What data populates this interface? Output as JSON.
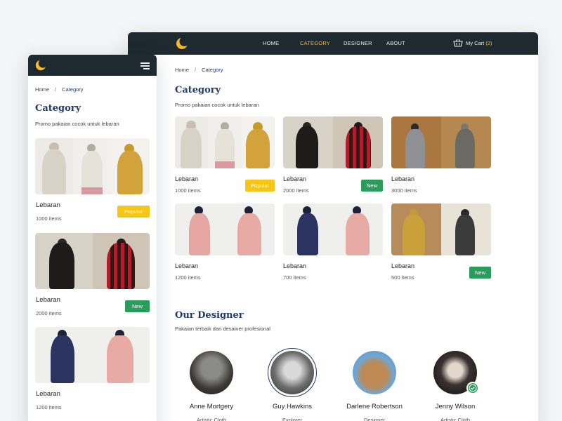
{
  "brand": {
    "logo": "crescent-moon-icon"
  },
  "desktop": {
    "nav": {
      "links": [
        {
          "label": "HOME",
          "active": false
        },
        {
          "label": "CATEGORY",
          "active": true
        },
        {
          "label": "DESIGNER",
          "active": false
        },
        {
          "label": "ABOUT",
          "active": false
        }
      ],
      "cart_label": "My Cart",
      "cart_count": "(2)",
      "cart_icon": "basket-icon"
    },
    "breadcrumb": {
      "home": "Home",
      "separator": "/",
      "current": "Category"
    },
    "category": {
      "title": "Category",
      "subtitle": "Promo pakaian cocok untuk lebaran",
      "cards": [
        {
          "name": "Lebaran",
          "count": "1000 items",
          "badge": "Popular"
        },
        {
          "name": "Lebaran",
          "count": "2000 items",
          "badge": "New"
        },
        {
          "name": "Lebaran",
          "count": "3000 items",
          "badge": ""
        },
        {
          "name": "Lebaran",
          "count": "1200 items",
          "badge": ""
        },
        {
          "name": "Lebaran",
          "count": "700 items",
          "badge": ""
        },
        {
          "name": "Lebaran",
          "count": "500 items",
          "badge": "New"
        }
      ]
    },
    "designers": {
      "title": "Our Designer",
      "subtitle": "Pakaian terbaik dari desainer profesional",
      "items": [
        {
          "name": "Anne Mortgery",
          "role": "Artistic Cloth",
          "verified": false
        },
        {
          "name": "Guy Hawkins",
          "role": "Explorer",
          "verified": false
        },
        {
          "name": "Darlene Robertson",
          "role": "Designer",
          "verified": false
        },
        {
          "name": "Jenny Wilson",
          "role": "Artistic Cloth",
          "verified": true
        }
      ]
    }
  },
  "mobile": {
    "menu_icon": "hamburger-menu-icon",
    "breadcrumb": {
      "home": "Home",
      "separator": "/",
      "current": "Category"
    },
    "category": {
      "title": "Category",
      "subtitle": "Promo pakaian cocok untuk lebaran",
      "cards": [
        {
          "name": "Lebaran",
          "count": "1000 items",
          "badge": "Popular"
        },
        {
          "name": "Lebaran",
          "count": "2000 items",
          "badge": "New"
        },
        {
          "name": "Lebaran",
          "count": "1200 items",
          "badge": ""
        }
      ]
    }
  },
  "colors": {
    "nav_bg": "#1f2a30",
    "accent": "#f5b82e",
    "heading": "#1f3a6e",
    "badge_popular": "#f5c518",
    "badge_new": "#2a9d5c"
  }
}
